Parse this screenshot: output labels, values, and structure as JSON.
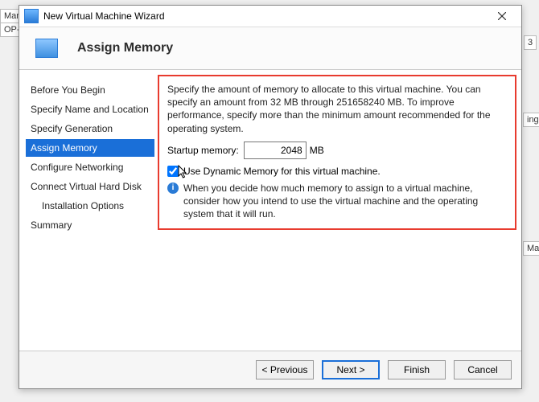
{
  "window": {
    "title": "New Virtual Machine Wizard"
  },
  "header": {
    "page_title": "Assign Memory"
  },
  "sidebar": {
    "steps": [
      {
        "label": "Before You Begin",
        "selected": false,
        "sub": false
      },
      {
        "label": "Specify Name and Location",
        "selected": false,
        "sub": false
      },
      {
        "label": "Specify Generation",
        "selected": false,
        "sub": false
      },
      {
        "label": "Assign Memory",
        "selected": true,
        "sub": false
      },
      {
        "label": "Configure Networking",
        "selected": false,
        "sub": false
      },
      {
        "label": "Connect Virtual Hard Disk",
        "selected": false,
        "sub": false
      },
      {
        "label": "Installation Options",
        "selected": false,
        "sub": true
      },
      {
        "label": "Summary",
        "selected": false,
        "sub": false
      }
    ]
  },
  "main": {
    "description": "Specify the amount of memory to allocate to this virtual machine. You can specify an amount from 32 MB through 251658240 MB. To improve performance, specify more than the minimum amount recommended for the operating system.",
    "startup_label": "Startup memory:",
    "startup_value": "2048",
    "startup_unit": "MB",
    "dynamic_checked": true,
    "dynamic_label": "Use Dynamic Memory for this virtual machine.",
    "info_text": "When you decide how much memory to assign to a virtual machine, consider how you intend to use the virtual machine and the operating system that it will run."
  },
  "footer": {
    "previous": "< Previous",
    "next": "Next >",
    "finish": "Finish",
    "cancel": "Cancel"
  },
  "background": {
    "frag1": "Manag",
    "frag2": "OP-V",
    "frag3": "3",
    "frag4": "ings",
    "frag5": "Man"
  }
}
